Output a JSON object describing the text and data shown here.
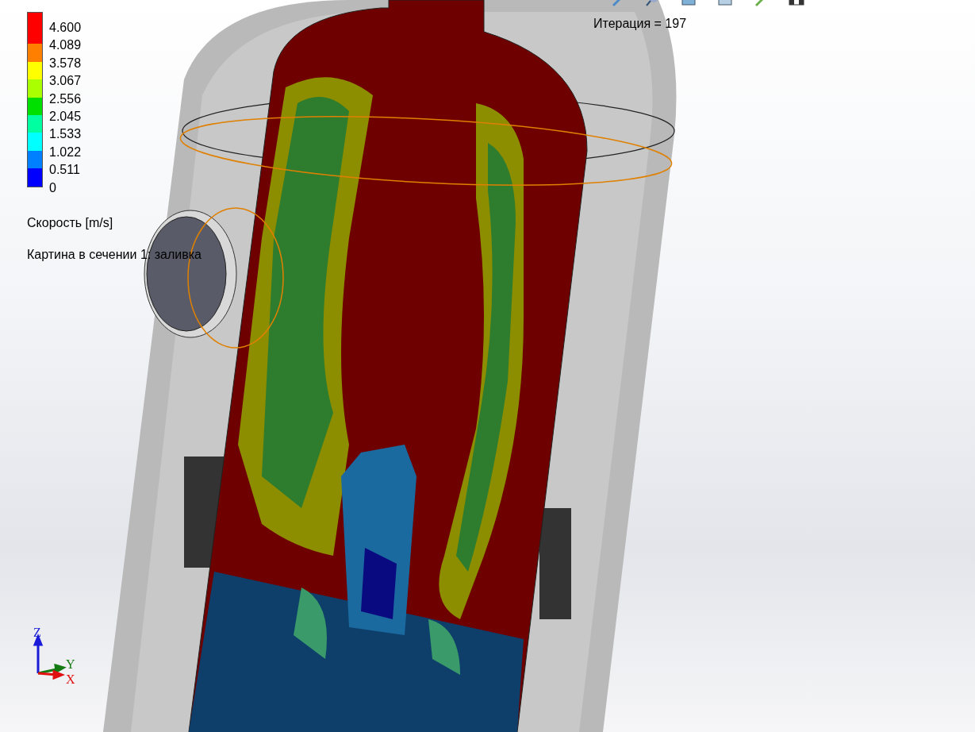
{
  "legend": {
    "bands": [
      {
        "color": "#ff0000"
      },
      {
        "color": "#ff0000"
      },
      {
        "color": "#ff8000"
      },
      {
        "color": "#ffff00"
      },
      {
        "color": "#aaff00"
      },
      {
        "color": "#00e000"
      },
      {
        "color": "#00ffa0"
      },
      {
        "color": "#00ffff"
      },
      {
        "color": "#0080ff"
      },
      {
        "color": "#0000ff"
      }
    ],
    "ticks": [
      "4.600",
      "4.089",
      "3.578",
      "3.067",
      "2.556",
      "2.045",
      "1.533",
      "1.022",
      "0.511",
      "0"
    ],
    "title": "Скорость [m/s]"
  },
  "caption": "Картина в сечении 1: заливка",
  "iteration": "Итерация = 197",
  "triad": {
    "axes": [
      {
        "kind": "z",
        "label": "Z"
      },
      {
        "kind": "y",
        "label": "Y"
      },
      {
        "kind": "x",
        "label": "X"
      }
    ]
  }
}
